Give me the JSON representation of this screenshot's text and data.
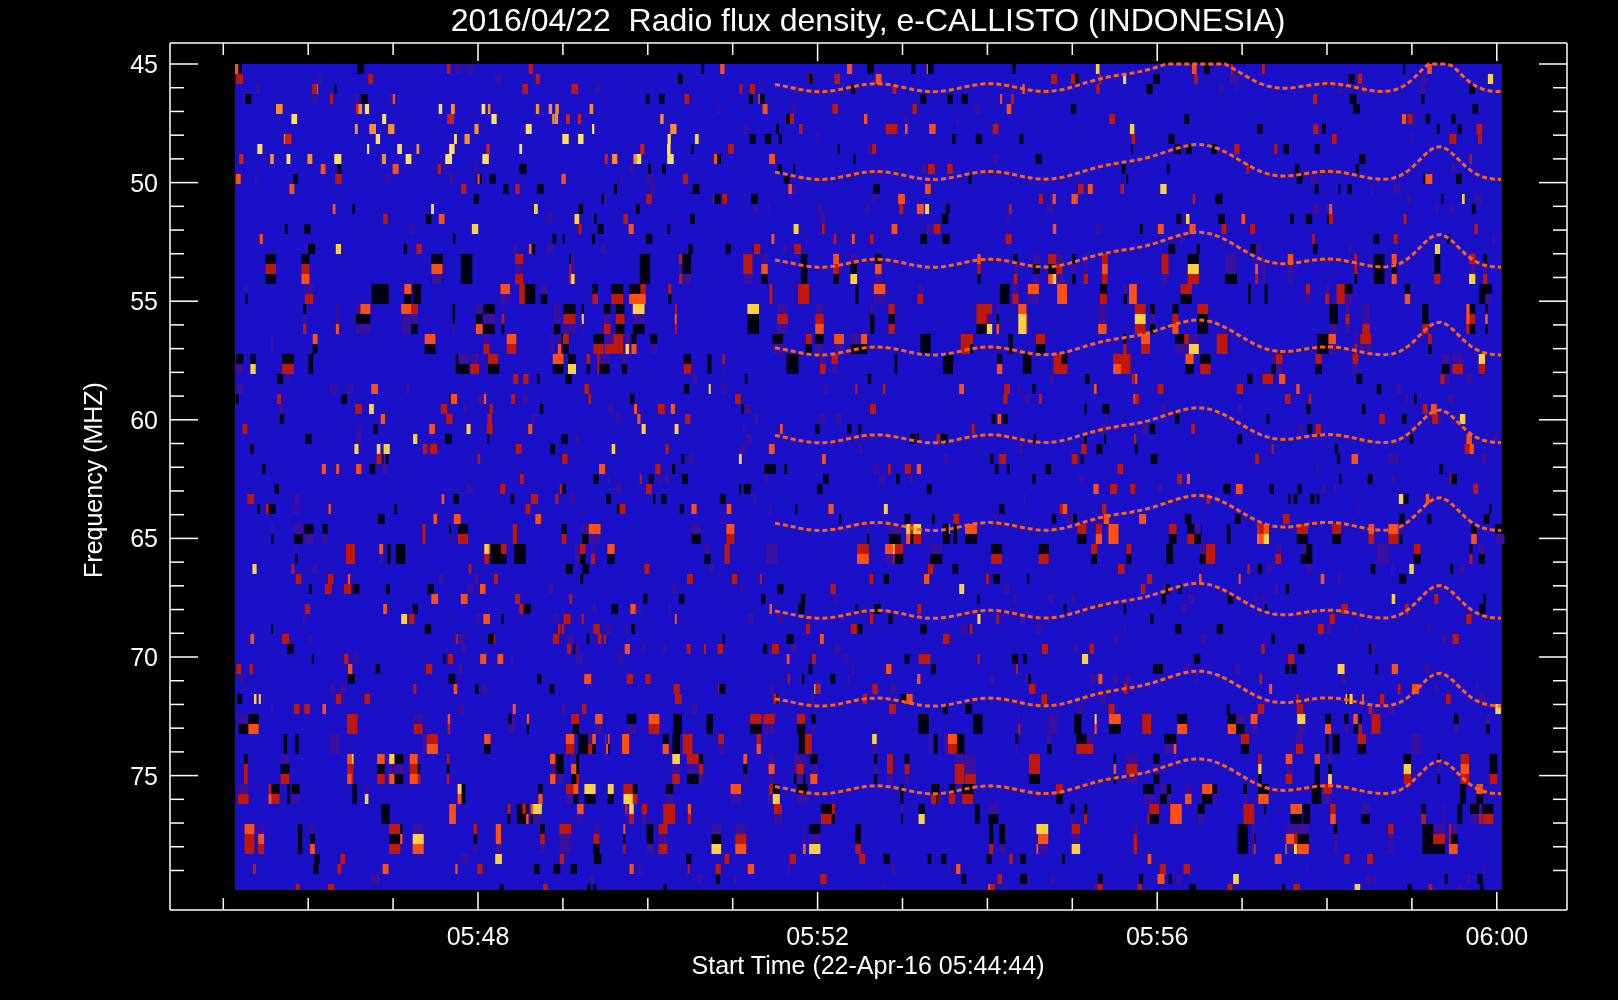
{
  "title": "2016/04/22  Radio flux density, e-CALLISTO (INDONESIA)",
  "y_axis": {
    "label": "Frequency (MHZ)",
    "ticks": [
      "45",
      "50",
      "55",
      "60",
      "65",
      "70",
      "75"
    ]
  },
  "x_axis": {
    "label": "Start Time (22-Apr-16 05:44:44)",
    "ticks": [
      "05:48",
      "05:52",
      "05:56",
      "06:00"
    ]
  }
}
